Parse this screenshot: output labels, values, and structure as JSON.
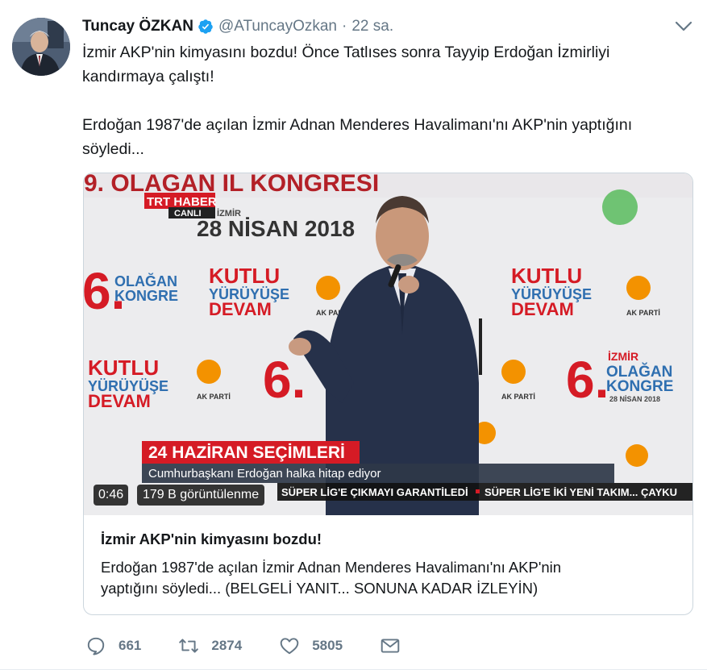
{
  "tweet": {
    "author": {
      "fullname": "Tuncay ÖZKAN",
      "handle": "@ATuncayOzkan",
      "separator": "·",
      "time": "22 sa.",
      "avatar_icon": "profile-photo"
    },
    "text": {
      "line1": "İzmir AKP'nin kimyasını bozdu! Önce Tatlıses sonra Tayyip Erdoğan İzmirliyi",
      "line2": "kandırmaya çalıştı!",
      "line3": "Erdoğan 1987'de açılan İzmir Adnan Menderes Havalimanı'nı AKP'nin yaptığını",
      "line4": "söyledi..."
    },
    "video": {
      "duration": "0:46",
      "views": "179 B görüntülenme",
      "overlay": {
        "banner_top": "9. OLAĞAN İL KONGRESİ",
        "channel": "TRT HABER",
        "live": "CANLI",
        "location": "İZMİR",
        "date": "28 NİSAN 2018",
        "backdrop_slogan_1": "KUTLU",
        "backdrop_slogan_2": "YÜRÜYÜŞE",
        "backdrop_slogan_3": "DEVAM",
        "backdrop_congress_1": "İZMİR",
        "backdrop_congress_2": "OLAĞAN",
        "backdrop_congress_3": "KONGRE",
        "backdrop_congress_date": "28 NİSAN 2018",
        "party": "AK PARTİ",
        "lower_third_title": "24 HAZİRAN SEÇİMLERİ",
        "lower_third_sub": "Cumhurbaşkanı Erdoğan halka hitap ediyor",
        "ticker_1": "SÜPER LİG'E ÇIKMAYI GARANTİLEDİ",
        "ticker_2": "SÜPER LİG'E İKİ YENİ TAKIM... ÇAYKU"
      }
    },
    "card": {
      "title": "İzmir AKP'nin kimyasını bozdu!",
      "description_line1": "Erdoğan 1987'de açılan İzmir Adnan Menderes Havalimanı'nı AKP'nin",
      "description_line2": "yaptığını söyledi... (BELGELİ YANIT... SONUNA KADAR İZLEYİN)"
    },
    "actions": {
      "replies": "661",
      "retweets": "2874",
      "likes": "5805",
      "reply_icon": "reply-icon",
      "retweet_icon": "retweet-icon",
      "like_icon": "heart-icon",
      "message_icon": "envelope-icon"
    },
    "colors": {
      "text": "#14171a",
      "secondary": "#657786",
      "verified": "#1da1f2",
      "border": "#e6ecf0",
      "trt_red": "#d51b25",
      "akp_orange": "#f39200"
    }
  }
}
